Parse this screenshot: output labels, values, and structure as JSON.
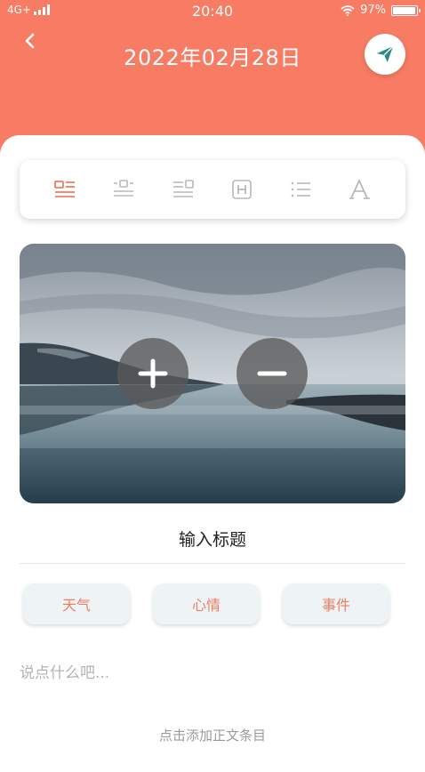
{
  "status_bar": {
    "network": "4G+",
    "time": "20:40",
    "battery_text": "97%",
    "battery_level": 0.97
  },
  "header": {
    "title": "2022年02月28日",
    "back_icon": "chevron-left-icon",
    "send_icon": "paper-plane-icon"
  },
  "toolbar": {
    "items": [
      {
        "icon": "align-image-left-icon",
        "active": true
      },
      {
        "icon": "align-image-center-icon",
        "active": false
      },
      {
        "icon": "align-image-right-icon",
        "active": false
      },
      {
        "icon": "heading-icon",
        "active": false
      },
      {
        "icon": "list-icon",
        "active": false
      },
      {
        "icon": "font-icon",
        "active": false
      }
    ]
  },
  "photo": {
    "zoom_in_icon": "plus-icon",
    "zoom_out_icon": "minus-icon"
  },
  "title_placeholder": "输入标题",
  "tags": {
    "weather": "天气",
    "mood": "心情",
    "event": "事件"
  },
  "body_placeholder": "说点什么吧...",
  "add_entry": "点击添加正文条目",
  "colors": {
    "accent": "#f77c63",
    "tag_text": "#f07c62",
    "tag_bg": "#eef4f6",
    "icon_active": "#f07c62",
    "icon_inactive": "#b8b8b8"
  }
}
